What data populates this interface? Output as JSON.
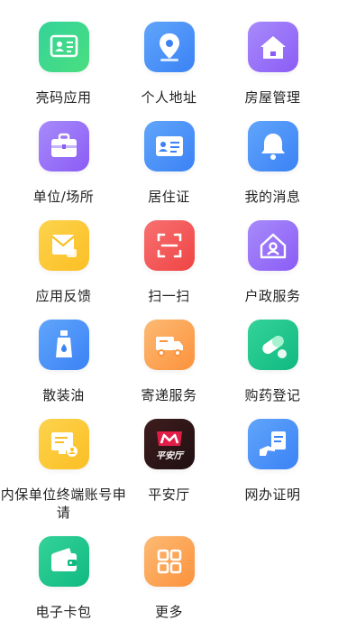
{
  "items": [
    {
      "label": "亮码应用",
      "icon": "card-id-icon",
      "color1": "#34d399",
      "color2": "#4ade80"
    },
    {
      "label": "个人地址",
      "icon": "location-pin-icon",
      "color1": "#60a5fa",
      "color2": "#3b82f6"
    },
    {
      "label": "房屋管理",
      "icon": "house-icon",
      "color1": "#a78bfa",
      "color2": "#8b5cf6"
    },
    {
      "label": "单位/场所",
      "icon": "briefcase-icon",
      "color1": "#a78bfa",
      "color2": "#8b5cf6"
    },
    {
      "label": "居住证",
      "icon": "residence-card-icon",
      "color1": "#60a5fa",
      "color2": "#3b82f6"
    },
    {
      "label": "我的消息",
      "icon": "bell-icon",
      "color1": "#60a5fa",
      "color2": "#3b82f6"
    },
    {
      "label": "应用反馈",
      "icon": "envelope-feedback-icon",
      "color1": "#fcd34d",
      "color2": "#fbbf24"
    },
    {
      "label": "扫一扫",
      "icon": "scan-icon",
      "color1": "#f87171",
      "color2": "#ef4444"
    },
    {
      "label": "户政服务",
      "icon": "household-service-icon",
      "color1": "#a78bfa",
      "color2": "#8b5cf6"
    },
    {
      "label": "散装油",
      "icon": "oil-bottle-icon",
      "color1": "#60a5fa",
      "color2": "#3b82f6"
    },
    {
      "label": "寄递服务",
      "icon": "delivery-truck-icon",
      "color1": "#fdba74",
      "color2": "#fb923c"
    },
    {
      "label": "购药登记",
      "icon": "pill-icon",
      "color1": "#34d399",
      "color2": "#10b981"
    },
    {
      "label": "内保单位终端账号申请",
      "icon": "terminal-account-icon",
      "color1": "#fcd34d",
      "color2": "#fbbf24"
    },
    {
      "label": "平安厅",
      "icon": "pingan-logo-icon",
      "color1": "#3f1d1d",
      "color2": "#1f0f12",
      "logo_text": "平安厅"
    },
    {
      "label": "网办证明",
      "icon": "hand-document-icon",
      "color1": "#60a5fa",
      "color2": "#3b82f6"
    },
    {
      "label": "电子卡包",
      "icon": "wallet-icon",
      "color1": "#34d399",
      "color2": "#10b981"
    },
    {
      "label": "更多",
      "icon": "grid-more-icon",
      "color1": "#fdba74",
      "color2": "#fb923c"
    }
  ]
}
